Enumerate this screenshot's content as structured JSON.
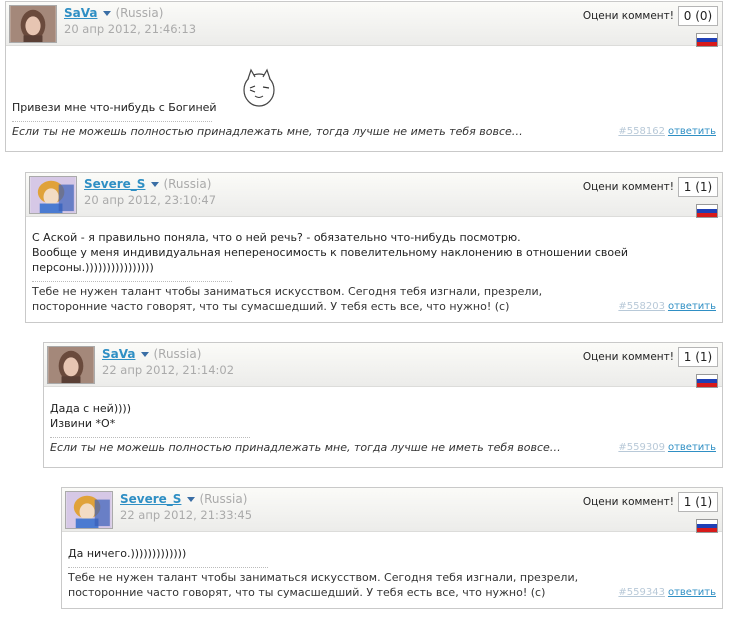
{
  "rate_label": "Оцени коммент!",
  "reply_label": "ответить",
  "flag_colors": [
    "#ffffff",
    "#1f3fb5",
    "#d71a1a"
  ],
  "accent_color": "#2f8fc4",
  "comments": [
    {
      "user": "SaVa",
      "country": "(Russia)",
      "timestamp": "20 апр 2012, 21:46:13",
      "rating": "0 (0)",
      "text": [
        "Привези мне что-нибудь с Богиней"
      ],
      "signature": "Если ты не можешь полностью принадлежать мне, тогда лучше не иметь тебя вовсе…",
      "id": "#558162",
      "has_smiley": true,
      "avatar_icon": "girl-photo-avatar"
    },
    {
      "user": "Severe_S",
      "country": "(Russia)",
      "timestamp": "20 апр 2012, 23:10:47",
      "rating": "1 (1)",
      "text": [
        "С Аской - я правильно поняла, что о ней речь? - обязательно что-нибудь посмотрю.",
        "Вообще у меня индивидуальная непереносимость к повелительному наклонению в отношении своей персоны.))))))))))))))))"
      ],
      "signature": "Тебе не нужен талант чтобы заниматься искусством. Сегодня тебя изгнали, презрели, посторонние часто говорят, что ты сумасшедший. У тебя есть все, что нужно! (c)",
      "id": "#558203",
      "avatar_icon": "anime-avatar"
    },
    {
      "user": "SaVa",
      "country": "(Russia)",
      "timestamp": "22 апр 2012, 21:14:02",
      "rating": "1 (1)",
      "text": [
        "Дада с ней))))",
        "Извини *О*"
      ],
      "signature": "Если ты не можешь полностью принадлежать мне, тогда лучше не иметь тебя вовсе…",
      "id": "#559309",
      "avatar_icon": "girl-photo-avatar"
    },
    {
      "user": "Severe_S",
      "country": "(Russia)",
      "timestamp": "22 апр 2012, 21:33:45",
      "rating": "1 (1)",
      "text": [
        "Да ничего.)))))))))))))"
      ],
      "signature": "Тебе не нужен талант чтобы заниматься искусством. Сегодня тебя изгнали, презрели, посторонние часто говорят, что ты сумасшедший. У тебя есть все, что нужно! (c)",
      "id": "#559343",
      "avatar_icon": "anime-avatar"
    }
  ]
}
